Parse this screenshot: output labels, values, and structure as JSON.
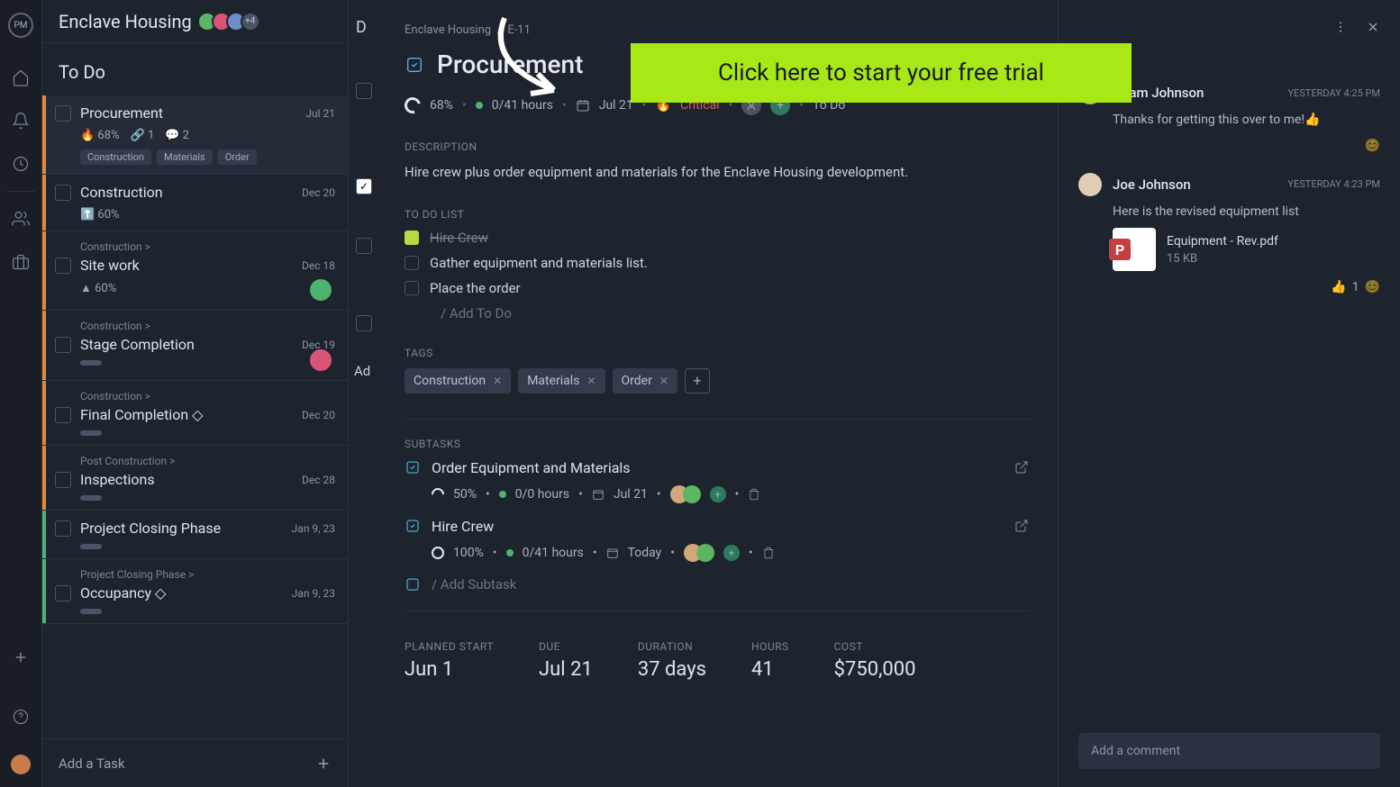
{
  "header": {
    "project": "Enclave Housing",
    "avatarsMore": "+4"
  },
  "sidebar": {
    "sectionTitle": "To Do",
    "tasks": [
      {
        "name": "Procurement",
        "date": "Jul 21",
        "pct": "68%",
        "clip": "1",
        "chat": "2",
        "tags": [
          "Construction",
          "Materials",
          "Order"
        ],
        "bar": "orange",
        "selected": true,
        "crumb": ""
      },
      {
        "name": "Construction",
        "date": "Dec 20",
        "pct": "60%",
        "bar": "orange",
        "crumb": "",
        "icon": "up"
      },
      {
        "name": "Site work",
        "date": "Dec 18",
        "pct": "60%",
        "bar": "orange",
        "crumb": "Construction >",
        "av": "g",
        "icon": "tri"
      },
      {
        "name": "Stage Completion",
        "date": "Dec 19",
        "bar": "orange",
        "crumb": "Construction >",
        "av": "r"
      },
      {
        "name": "Final Completion ◇",
        "date": "Dec 20",
        "bar": "orange",
        "crumb": "Construction >"
      },
      {
        "name": "Inspections",
        "date": "Dec 28",
        "bar": "orange",
        "crumb": "Post Construction >",
        "icon": "tri"
      },
      {
        "name": "Project Closing Phase",
        "date": "Jan 9, 23",
        "bar": "green",
        "crumb": ""
      },
      {
        "name": "Occupancy ◇",
        "date": "Jan 9, 23",
        "bar": "green",
        "crumb": "Project Closing Phase >"
      }
    ],
    "addTask": "Add a Task"
  },
  "col2": {
    "letter": "D",
    "add": "Ad"
  },
  "detail": {
    "breadcrumb": {
      "project": "Enclave Housing",
      "sep": "/",
      "id": "E-11"
    },
    "title": "Procurement",
    "doneLabel": "Done",
    "progress": "68%",
    "hours": "0/41 hours",
    "due": "Jul 21",
    "priority": "Critical",
    "status": "To Do",
    "descLabel": "DESCRIPTION",
    "description": "Hire crew plus order equipment and materials for the Enclave Housing development.",
    "todoLabel": "TO DO LIST",
    "todos": [
      {
        "text": "Hire Crew",
        "done": true
      },
      {
        "text": "Gather equipment and materials list.",
        "done": false
      },
      {
        "text": "Place the order",
        "done": false
      }
    ],
    "addTodo": "/ Add To Do",
    "tagsLabel": "TAGS",
    "tags": [
      "Construction",
      "Materials",
      "Order"
    ],
    "subLabel": "SUBTASKS",
    "subtasks": [
      {
        "name": "Order Equipment and Materials",
        "pct": "50%",
        "hours": "0/0 hours",
        "due": "Jul 21"
      },
      {
        "name": "Hire Crew",
        "pct": "100%",
        "hours": "0/41 hours",
        "due": "Today"
      }
    ],
    "addSub": "/ Add Subtask",
    "stats": [
      {
        "label": "PLANNED START",
        "val": "Jun 1"
      },
      {
        "label": "DUE",
        "val": "Jul 21"
      },
      {
        "label": "DURATION",
        "val": "37 days"
      },
      {
        "label": "HOURS",
        "val": "41"
      },
      {
        "label": "COST",
        "val": "$750,000"
      }
    ]
  },
  "comments": [
    {
      "name": "Adam Johnson",
      "time": "YESTERDAY 4:25 PM",
      "body": "Thanks for getting this over to me!👍"
    },
    {
      "name": "Joe Johnson",
      "time": "YESTERDAY 4:23 PM",
      "body": "Here is the revised equipment list",
      "file": {
        "name": "Equipment - Rev.pdf",
        "size": "15 KB"
      }
    }
  ],
  "reactCount": "1",
  "addComment": "Add a comment",
  "promo": "Click here to start your free trial"
}
